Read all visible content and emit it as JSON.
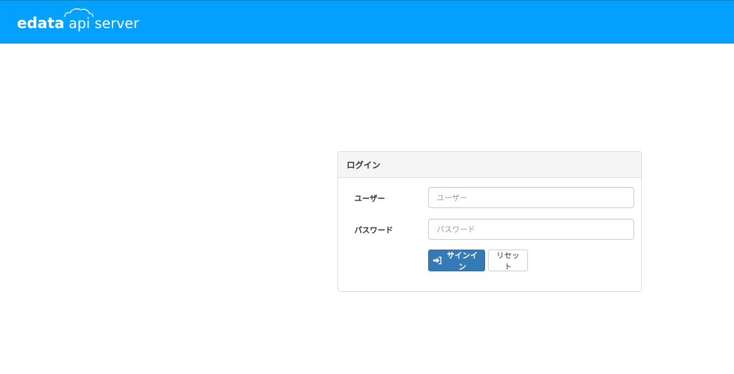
{
  "header": {
    "brand_mark": "edata",
    "brand_text": "api server",
    "background_color": "#03a0fe"
  },
  "login_panel": {
    "title": "ログイン",
    "user_label": "ユーザー",
    "user_placeholder": "ユーザー",
    "user_value": "",
    "password_label": "パスワード",
    "password_placeholder": "パスワード",
    "password_value": "",
    "signin_icon": "sign-in-icon",
    "signin_label": "サインイン",
    "reset_label": "リセット",
    "primary_color": "#337ab7"
  }
}
